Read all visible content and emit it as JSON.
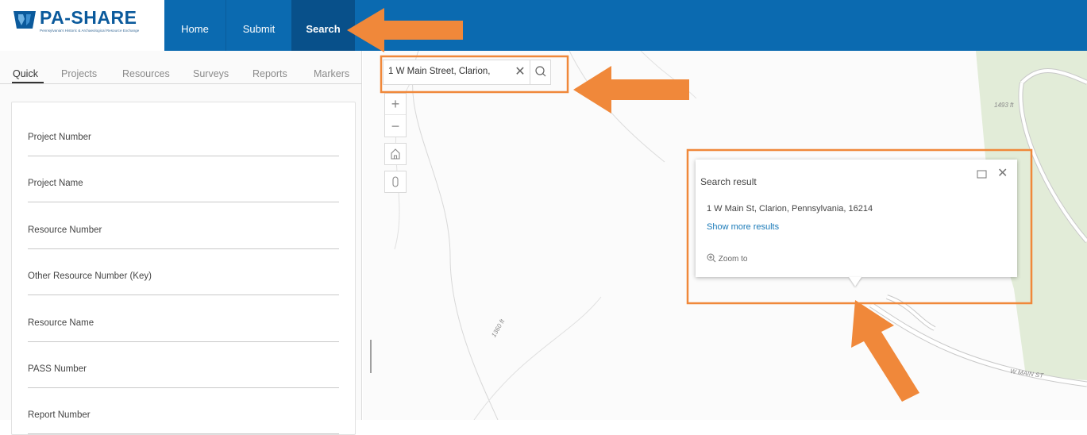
{
  "app": {
    "logo_text": "PA-SHARE",
    "logo_subtext": "Pennsylvania's Historic & Archaeological Resource Exchange"
  },
  "nav": {
    "home": "Home",
    "submit": "Submit",
    "search": "Search"
  },
  "tabs": [
    "Quick",
    "Projects",
    "Resources",
    "Surveys",
    "Reports",
    "Markers"
  ],
  "fields": [
    "Project Number",
    "Project Name",
    "Resource Number",
    "Other Resource Number (Key)",
    "Resource Name",
    "PASS Number",
    "Report Number"
  ],
  "search": {
    "value": "1 W Main Street, Clarion,"
  },
  "popup": {
    "title": "Search result",
    "address": "1 W Main St, Clarion, Pennsylvania, 16214",
    "more_link": "Show more results",
    "zoom_label": "Zoom to"
  },
  "map_labels": {
    "elev_1": "1493 ft",
    "elev_2": "1360 ft",
    "street": "W MAIN ST"
  },
  "colors": {
    "header": "#0b6ab0",
    "annotation": "#f0883a",
    "link": "#1a7ab8"
  }
}
